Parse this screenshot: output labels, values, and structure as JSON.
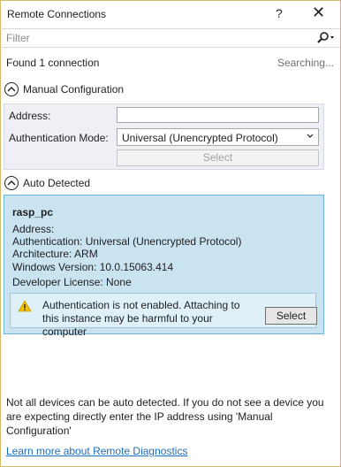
{
  "window": {
    "title": "Remote Connections",
    "help": "?",
    "close": "✕"
  },
  "filter": {
    "placeholder": "Filter"
  },
  "status": {
    "found": "Found 1 connection",
    "searching": "Searching..."
  },
  "manual": {
    "header": "Manual Configuration",
    "address_label": "Address:",
    "address_value": "",
    "auth_label": "Authentication Mode:",
    "auth_value": "Universal (Unencrypted Protocol)",
    "select_label": "Select"
  },
  "auto": {
    "header": "Auto Detected",
    "device": {
      "name": "rasp_pc",
      "address": "Address:",
      "authentication": "Authentication: Universal (Unencrypted Protocol)",
      "architecture": "Architecture: ARM",
      "windows_version": "Windows Version: 10.0.15063.414",
      "developer_license": "Developer License: None",
      "warning": "Authentication is not enabled. Attaching to this instance may be harmful to your computer",
      "select_label": "Select"
    }
  },
  "footer": {
    "note": "Not all devices can be auto detected. If you do not see a device you are expecting directly enter the IP address using 'Manual Configuration'",
    "link": "Learn more about Remote Diagnostics"
  },
  "colors": {
    "accent_border": "#d8b96a",
    "device_bg": "#c9e3f1",
    "device_border": "#6fb5da",
    "link": "#1a6ec2",
    "warning": "#f2c200"
  }
}
